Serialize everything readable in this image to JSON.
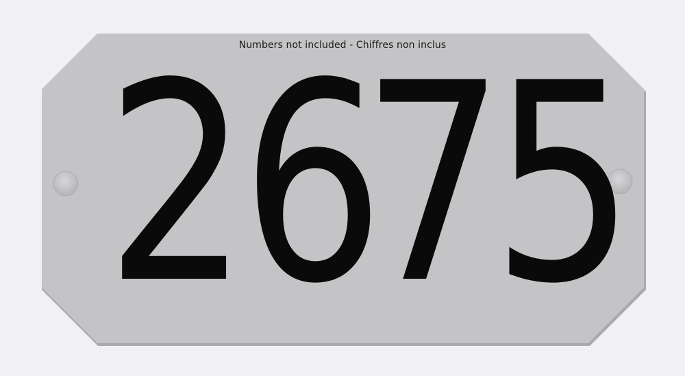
{
  "plaque": {
    "notice": "Numbers not included - Chiffres non inclus",
    "digits": [
      "2",
      "6",
      "7",
      "5"
    ]
  },
  "colors": {
    "background": "#f1f1f3",
    "plaque": "#c3c3c5",
    "digits": "#0a0a0a"
  }
}
